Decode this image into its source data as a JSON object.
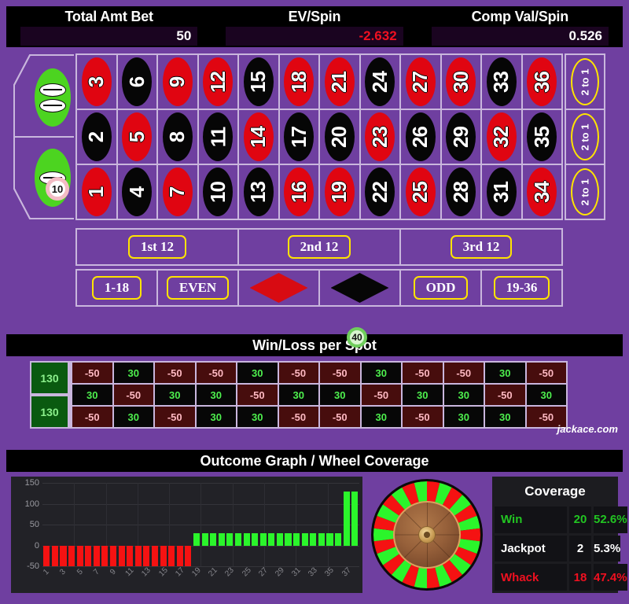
{
  "header": {
    "stats": [
      {
        "label": "Total Amt Bet",
        "value": "50",
        "negative": false
      },
      {
        "label": "EV/Spin",
        "value": "-2.632",
        "negative": true
      },
      {
        "label": "Comp Val/Spin",
        "value": "0.526",
        "negative": false
      }
    ]
  },
  "table": {
    "zeros": [
      {
        "name": "double-zero",
        "label": "00",
        "glyphs": 2
      },
      {
        "name": "zero",
        "label": "0",
        "glyphs": 1
      }
    ],
    "chips": [
      {
        "name": "chip-on-zero-split",
        "amount": "10"
      },
      {
        "name": "chip-on-black",
        "amount": "40"
      }
    ],
    "numbers": [
      {
        "n": "3",
        "color": "red"
      },
      {
        "n": "6",
        "color": "black"
      },
      {
        "n": "9",
        "color": "red"
      },
      {
        "n": "12",
        "color": "red"
      },
      {
        "n": "15",
        "color": "black"
      },
      {
        "n": "18",
        "color": "red"
      },
      {
        "n": "21",
        "color": "red"
      },
      {
        "n": "24",
        "color": "black"
      },
      {
        "n": "27",
        "color": "red"
      },
      {
        "n": "30",
        "color": "red"
      },
      {
        "n": "33",
        "color": "black"
      },
      {
        "n": "36",
        "color": "red"
      },
      {
        "n": "2",
        "color": "black"
      },
      {
        "n": "5",
        "color": "red"
      },
      {
        "n": "8",
        "color": "black"
      },
      {
        "n": "11",
        "color": "black"
      },
      {
        "n": "14",
        "color": "red"
      },
      {
        "n": "17",
        "color": "black"
      },
      {
        "n": "20",
        "color": "black"
      },
      {
        "n": "23",
        "color": "red"
      },
      {
        "n": "26",
        "color": "black"
      },
      {
        "n": "29",
        "color": "black"
      },
      {
        "n": "32",
        "color": "red"
      },
      {
        "n": "35",
        "color": "black"
      },
      {
        "n": "1",
        "color": "red"
      },
      {
        "n": "4",
        "color": "black"
      },
      {
        "n": "7",
        "color": "red"
      },
      {
        "n": "10",
        "color": "black"
      },
      {
        "n": "13",
        "color": "black"
      },
      {
        "n": "16",
        "color": "red"
      },
      {
        "n": "19",
        "color": "red"
      },
      {
        "n": "22",
        "color": "black"
      },
      {
        "n": "25",
        "color": "red"
      },
      {
        "n": "28",
        "color": "black"
      },
      {
        "n": "31",
        "color": "black"
      },
      {
        "n": "34",
        "color": "red"
      }
    ],
    "column_bets": [
      {
        "label": "2 to 1"
      },
      {
        "label": "2 to 1"
      },
      {
        "label": "2 to 1"
      }
    ],
    "dozens": [
      {
        "label": "1st 12"
      },
      {
        "label": "2nd 12"
      },
      {
        "label": "3rd 12"
      }
    ],
    "outside": [
      {
        "type": "pill",
        "label": "1-18"
      },
      {
        "type": "pill",
        "label": "EVEN"
      },
      {
        "type": "diamond",
        "label": "RED",
        "color": "red"
      },
      {
        "type": "diamond",
        "label": "BLACK",
        "color": "black"
      },
      {
        "type": "pill",
        "label": "ODD"
      },
      {
        "type": "pill",
        "label": "19-36"
      }
    ]
  },
  "winloss": {
    "title": "Win/Loss per Spot",
    "zeros": [
      "130",
      "130"
    ],
    "rows": [
      [
        "-50",
        "30",
        "-50",
        "-50",
        "30",
        "-50",
        "-50",
        "30",
        "-50",
        "-50",
        "30",
        "-50"
      ],
      [
        "30",
        "-50",
        "30",
        "30",
        "-50",
        "30",
        "30",
        "-50",
        "30",
        "30",
        "-50",
        "30"
      ],
      [
        "-50",
        "30",
        "-50",
        "30",
        "30",
        "-50",
        "-50",
        "30",
        "-50",
        "30",
        "30",
        "-50"
      ]
    ],
    "watermark": "jackace.com"
  },
  "graph": {
    "title": "Outcome Graph / Wheel Coverage"
  },
  "coverage": {
    "title": "Coverage",
    "rows": [
      {
        "name": "Win",
        "count": "20",
        "pct": "52.6%",
        "color": "#22c522"
      },
      {
        "name": "Jackpot",
        "count": "2",
        "pct": "5.3%",
        "color": "#ffffff"
      },
      {
        "name": "Whack",
        "count": "18",
        "pct": "47.4%",
        "color": "#f01020"
      }
    ]
  },
  "chart_data": {
    "type": "bar",
    "title": "Outcome Graph / Wheel Coverage",
    "xlabel": "",
    "ylabel": "",
    "ylim": [
      -50,
      150
    ],
    "yticks": [
      150,
      100,
      50,
      0,
      -50
    ],
    "grid": true,
    "legend": null,
    "x": [
      1,
      2,
      3,
      4,
      5,
      6,
      7,
      8,
      9,
      10,
      11,
      12,
      13,
      14,
      15,
      16,
      17,
      18,
      19,
      20,
      21,
      22,
      23,
      24,
      25,
      26,
      27,
      28,
      29,
      30,
      31,
      32,
      33,
      34,
      35,
      36,
      37,
      38
    ],
    "xtick_labels": [
      "1",
      "3",
      "5",
      "7",
      "9",
      "11",
      "13",
      "15",
      "17",
      "19",
      "21",
      "23",
      "25",
      "27",
      "29",
      "31",
      "33",
      "35",
      "37"
    ],
    "values": [
      -50,
      -50,
      -50,
      -50,
      -50,
      -50,
      -50,
      -50,
      -50,
      -50,
      -50,
      -50,
      -50,
      -50,
      -50,
      -50,
      -50,
      -50,
      30,
      30,
      30,
      30,
      30,
      30,
      30,
      30,
      30,
      30,
      30,
      30,
      30,
      30,
      30,
      30,
      30,
      30,
      130,
      130
    ],
    "bar_colors": [
      "#f51212",
      "#f51212",
      "#f51212",
      "#f51212",
      "#f51212",
      "#f51212",
      "#f51212",
      "#f51212",
      "#f51212",
      "#f51212",
      "#f51212",
      "#f51212",
      "#f51212",
      "#f51212",
      "#f51212",
      "#f51212",
      "#f51212",
      "#f51212",
      "#2bf52b",
      "#2bf52b",
      "#2bf52b",
      "#2bf52b",
      "#2bf52b",
      "#2bf52b",
      "#2bf52b",
      "#2bf52b",
      "#2bf52b",
      "#2bf52b",
      "#2bf52b",
      "#2bf52b",
      "#2bf52b",
      "#2bf52b",
      "#2bf52b",
      "#2bf52b",
      "#2bf52b",
      "#2bf52b",
      "#2bf52b",
      "#2bf52b"
    ]
  },
  "wheel": {
    "segments": 26,
    "colors": [
      "#f51212",
      "#2bf52b"
    ]
  }
}
